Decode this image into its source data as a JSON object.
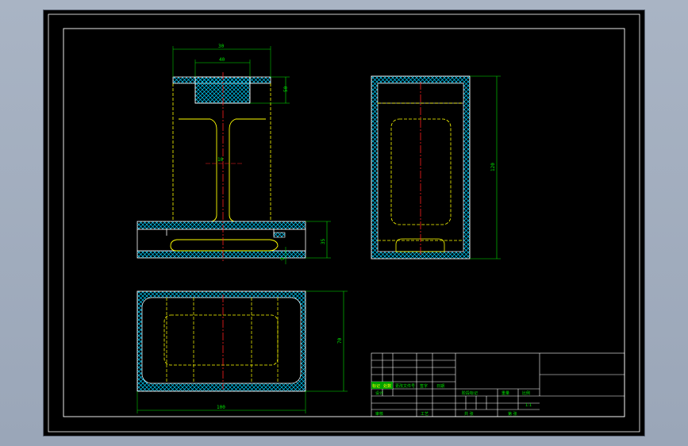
{
  "colors": {
    "background": "#000000",
    "frame": "#ffffff",
    "outline": "#ffff00",
    "centerline": "#ff2020",
    "dimension": "#00e600",
    "hatch": "#00d0ff"
  },
  "dimensions": {
    "front_top_width": "30",
    "front_inner_width": "40",
    "front_top_height": "50",
    "front_web": "10",
    "front_base_height": "35",
    "front_small": "9",
    "side_height": "120",
    "plan_height": "70",
    "plan_width": "100"
  },
  "title_block": {
    "row_labels": [
      "标记",
      "处数",
      "更改文件号",
      "签字",
      "日期"
    ],
    "design": "设计",
    "review": "审核",
    "process": "工艺",
    "stage_label": "阶段标记",
    "weight_label": "重量",
    "scale_label": "比例",
    "scale_value": "1:1",
    "sheet_total": "共 张",
    "sheet_no": "第 张"
  }
}
